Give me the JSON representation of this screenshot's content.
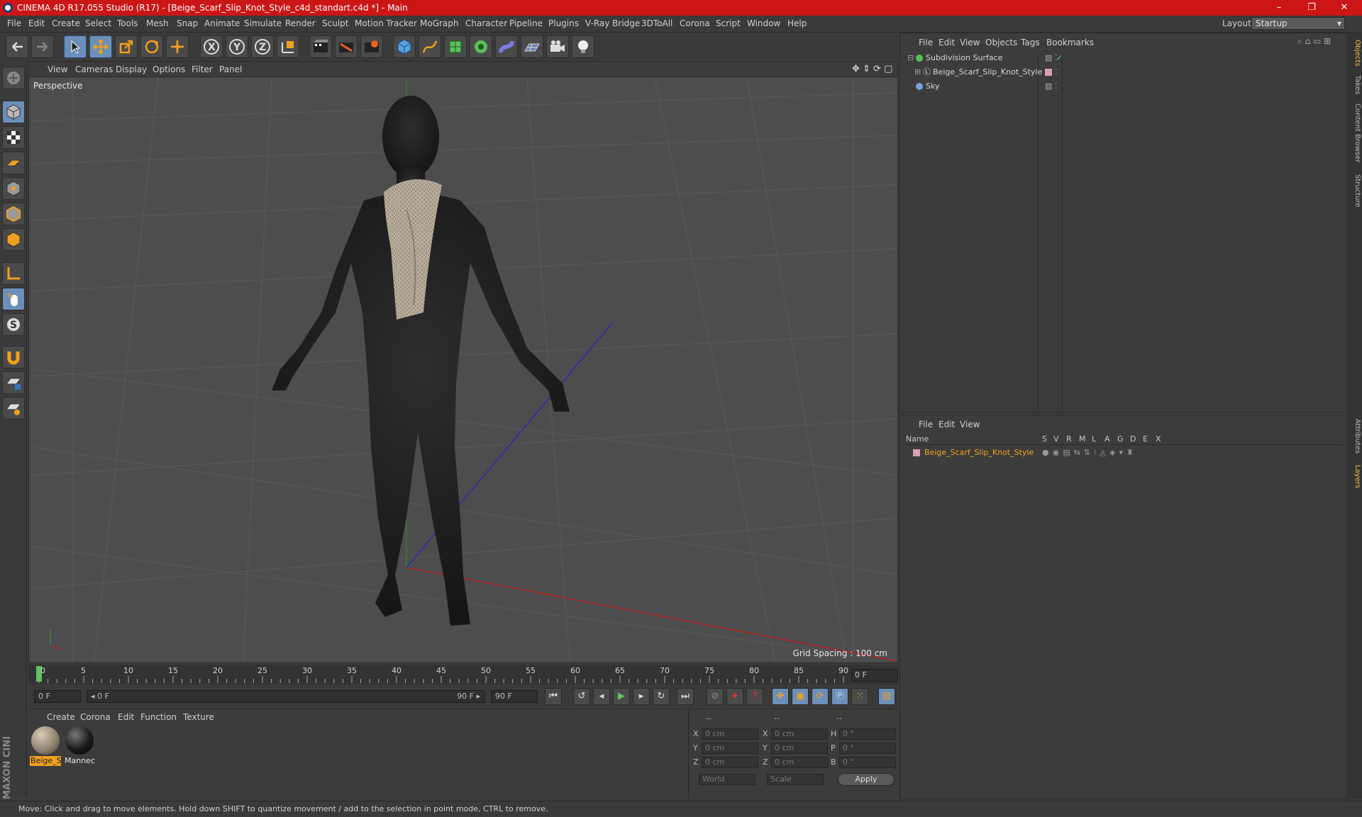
{
  "window": {
    "title": "CINEMA 4D R17.055 Studio (R17) - [Beige_Scarf_Slip_Knot_Style_c4d_standart.c4d *] - Main",
    "minimize": "–",
    "restore": "❐",
    "close": "✕"
  },
  "menubar": {
    "items": [
      "File",
      "Edit",
      "Create",
      "Select",
      "Tools",
      "Mesh",
      "Snap",
      "Animate",
      "Simulate",
      "Render",
      "Sculpt",
      "Motion Tracker",
      "MoGraph",
      "Character",
      "Pipeline",
      "Plugins",
      "V-Ray Bridge",
      "3DToAll",
      "Corona",
      "Script",
      "Window",
      "Help"
    ],
    "layout_label": "Layout:",
    "layout_value": "Startup"
  },
  "viewport": {
    "menu": [
      "View",
      "Cameras",
      "Display",
      "Options",
      "Filter",
      "Panel"
    ],
    "label": "Perspective",
    "grid_spacing": "Grid Spacing : 100 cm"
  },
  "timeline": {
    "ticks": [
      "0",
      "5",
      "10",
      "15",
      "20",
      "25",
      "30",
      "35",
      "40",
      "45",
      "50",
      "55",
      "60",
      "65",
      "70",
      "75",
      "80",
      "85",
      "90"
    ],
    "current_frame": "0 F"
  },
  "transport": {
    "start_field": "0 F",
    "range_start": "◂ 0 F",
    "range_end": "90 F ▸",
    "end_field": "90 F"
  },
  "materials": {
    "menu": [
      "Create",
      "Corona",
      "Edit",
      "Function",
      "Texture"
    ],
    "items": [
      {
        "label": "Beige_S",
        "selected": true
      },
      {
        "label": "Mannec",
        "selected": false
      }
    ]
  },
  "coords": {
    "header_a": "--",
    "header_b": "--",
    "header_c": "--",
    "rows": [
      {
        "l1": "X",
        "v1": "0 cm",
        "l2": "X",
        "v2": "0 cm",
        "l3": "H",
        "v3": "0 °"
      },
      {
        "l1": "Y",
        "v1": "0 cm",
        "l2": "Y",
        "v2": "0 cm",
        "l3": "P",
        "v3": "0 °"
      },
      {
        "l1": "Z",
        "v1": "0 cm",
        "l2": "Z",
        "v2": "0 cm",
        "l3": "B",
        "v3": "0 °"
      }
    ],
    "mode1": "World",
    "mode2": "Scale",
    "apply": "Apply"
  },
  "status": "Move: Click and drag to move elements. Hold down SHIFT to quantize movement / add to the selection in point mode, CTRL to remove.",
  "objects": {
    "menu": [
      "File",
      "Edit",
      "View",
      "Objects",
      "Tags",
      "Bookmarks"
    ],
    "items": [
      {
        "name": "Subdivision Surface"
      },
      {
        "name": "Beige_Scarf_Slip_Knot_Style"
      },
      {
        "name": "Sky"
      }
    ]
  },
  "layers": {
    "menu": [
      "File",
      "Edit",
      "View"
    ],
    "name_header": "Name",
    "flags": [
      "S",
      "V",
      "R",
      "M",
      "L",
      "A",
      "G",
      "D",
      "E",
      "X"
    ],
    "items": [
      {
        "name": "Beige_Scarf_Slip_Knot_Style"
      }
    ]
  },
  "side_tabs": {
    "top": [
      "Objects",
      "Takes",
      "Content Browser",
      "Structure"
    ],
    "bottom": [
      "Attributes",
      "Layers"
    ]
  },
  "branding": "MAXON CINEMA 4D",
  "colors": {
    "title_red": "#cc1616",
    "accent_orange": "#f0a020",
    "selection_blue": "#6b8fb8"
  }
}
